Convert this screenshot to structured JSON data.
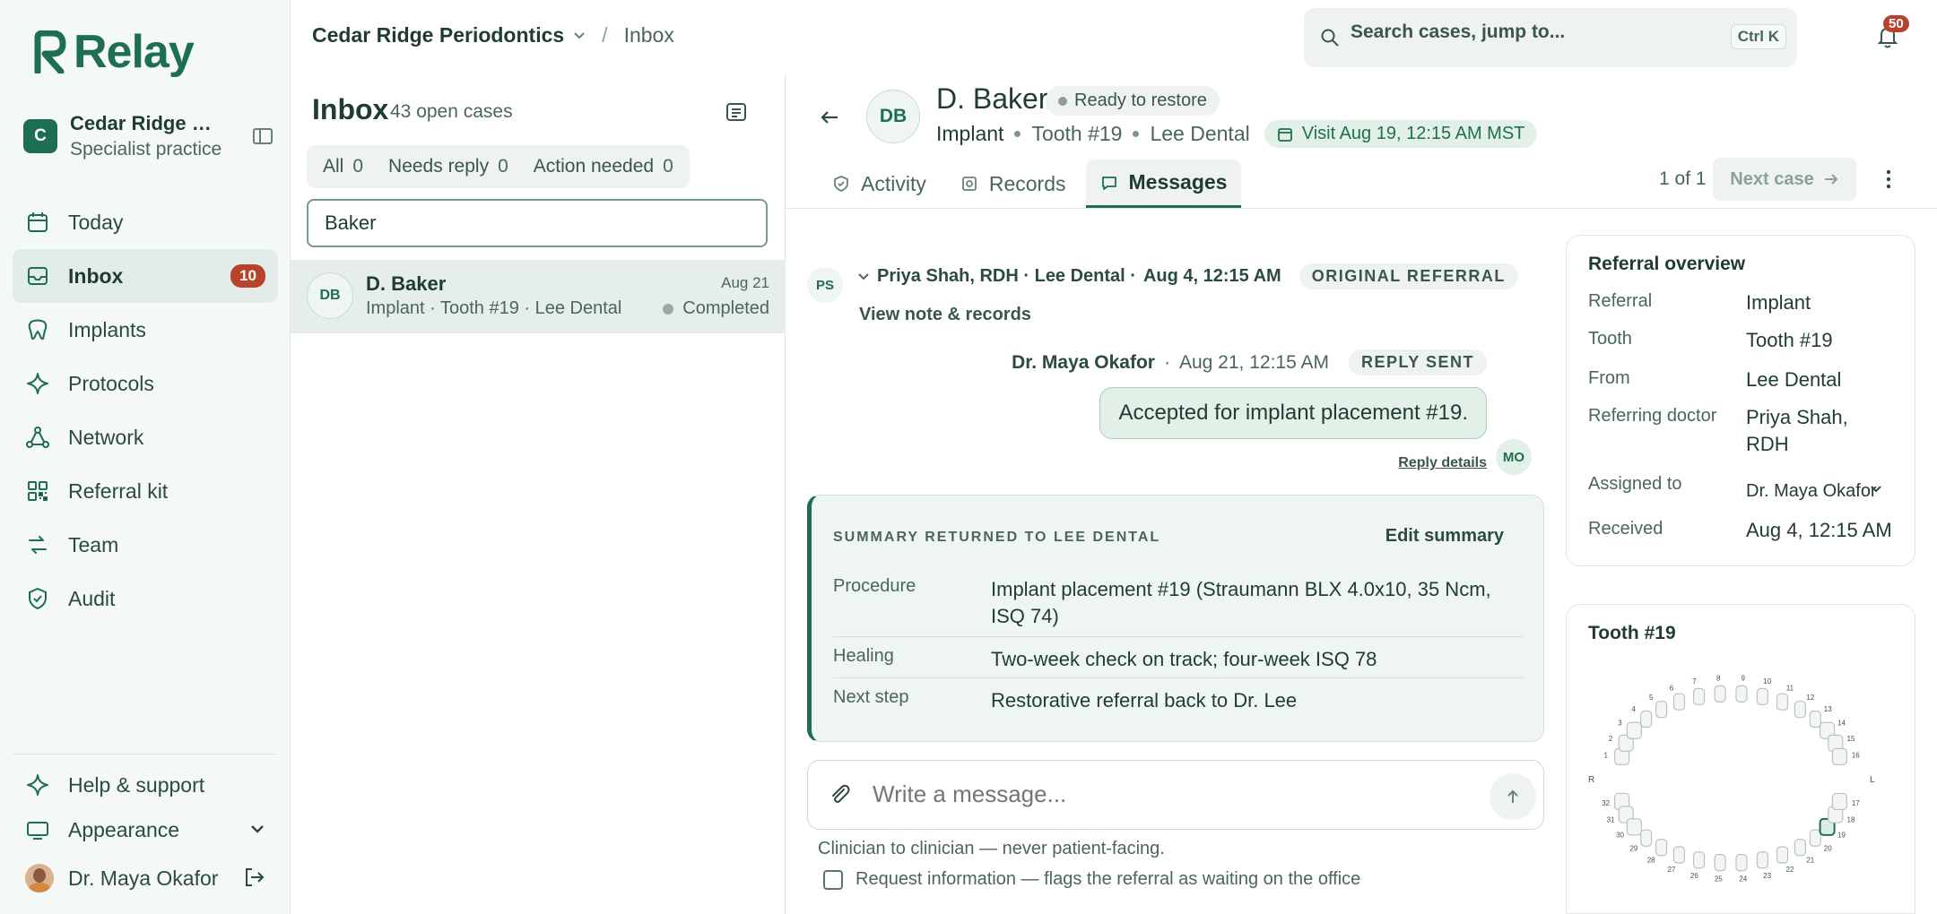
{
  "app": {
    "name": "Relay"
  },
  "org": {
    "name": "Cedar Ridge Periodontics",
    "name_truncated": "Cedar Ridge P...",
    "subtitle": "Specialist practice",
    "initial": "C"
  },
  "nav": {
    "items": [
      {
        "label": "Today",
        "icon": "calendar-icon"
      },
      {
        "label": "Inbox",
        "icon": "inbox-icon",
        "badge": "10"
      },
      {
        "label": "Implants",
        "icon": "tooth-icon"
      },
      {
        "label": "Protocols",
        "icon": "sparkle-icon"
      },
      {
        "label": "Network",
        "icon": "network-icon"
      },
      {
        "label": "Referral kit",
        "icon": "qr-icon"
      },
      {
        "label": "Team",
        "icon": "team-icon"
      },
      {
        "label": "Audit",
        "icon": "shield-icon"
      }
    ],
    "help": "Help & support",
    "appearance": "Appearance",
    "user": "Dr. Maya Okafor"
  },
  "topbar": {
    "org": "Cedar Ridge Periodontics",
    "separator": "/",
    "current": "Inbox",
    "search_placeholder": "Search cases, jump to...",
    "shortcut": "Ctrl K",
    "notifications": "50"
  },
  "inbox": {
    "title": "Inbox",
    "count": "43 open cases",
    "filters": [
      {
        "label": "All",
        "count": "0"
      },
      {
        "label": "Needs reply",
        "count": "0"
      },
      {
        "label": "Action needed",
        "count": "0"
      }
    ],
    "search_value": "Baker",
    "rows": [
      {
        "initials": "DB",
        "name": "D. Baker",
        "sub": "Implant · Tooth #19 · Lee Dental",
        "date": "Aug 21",
        "status": "Completed"
      }
    ]
  },
  "case": {
    "initials": "DB",
    "name": "D. Baker",
    "status": "Ready to restore",
    "type": "Implant",
    "tooth": "Tooth #19",
    "office": "Lee Dental",
    "visit": "Visit Aug 19, 12:15 AM MST",
    "tabs": [
      "Activity",
      "Records",
      "Messages"
    ],
    "pager": "1 of 1",
    "next": "Next case"
  },
  "thread": {
    "original": {
      "initials": "PS",
      "author": "Priya Shah, RDH · Lee Dental ·",
      "time": "Aug 4, 12:15 AM",
      "tag": "ORIGINAL REFERRAL",
      "link": "View note & records"
    },
    "reply": {
      "author": "Dr. Maya Okafor",
      "dot": "·",
      "time": "Aug 21, 12:15 AM",
      "tag": "REPLY SENT",
      "body": "Accepted for implant placement #19.",
      "details": "Reply details",
      "initials": "MO"
    },
    "summary": {
      "title": "SUMMARY RETURNED TO LEE DENTAL",
      "edit": "Edit summary",
      "rows": [
        {
          "k": "Procedure",
          "v": "Implant placement #19 (Straumann BLX 4.0x10, 35 Ncm, ISQ 74)"
        },
        {
          "k": "Healing",
          "v": "Two-week check on track; four-week ISQ 78"
        },
        {
          "k": "Next step",
          "v": "Restorative referral back to Dr. Lee"
        }
      ]
    },
    "composer_placeholder": "Write a message...",
    "hint": "Clinician to clinician — never patient-facing.",
    "request": "Request information — flags the referral as waiting on the office"
  },
  "overview": {
    "title": "Referral overview",
    "rows": [
      {
        "k": "Referral",
        "v": "Implant"
      },
      {
        "k": "Tooth",
        "v": "Tooth #19"
      },
      {
        "k": "From",
        "v": "Lee Dental"
      },
      {
        "k": "Referring doctor",
        "v": "Priya Shah, RDH"
      },
      {
        "k": "Assigned to",
        "v": "Dr. Maya Okafor"
      },
      {
        "k": "Received",
        "v": "Aug 4, 12:15 AM"
      }
    ]
  },
  "tooth_chart": {
    "title": "Tooth #19",
    "right_label": "R",
    "left_label": "L",
    "upper": [
      "1",
      "2",
      "3",
      "4",
      "5",
      "6",
      "7",
      "8",
      "9",
      "10",
      "11",
      "12",
      "13",
      "14",
      "15",
      "16"
    ],
    "lower": [
      "17",
      "18",
      "19",
      "20",
      "21",
      "22",
      "23",
      "24",
      "25",
      "26",
      "27",
      "28",
      "29",
      "30",
      "31",
      "32"
    ],
    "selected": "19"
  }
}
